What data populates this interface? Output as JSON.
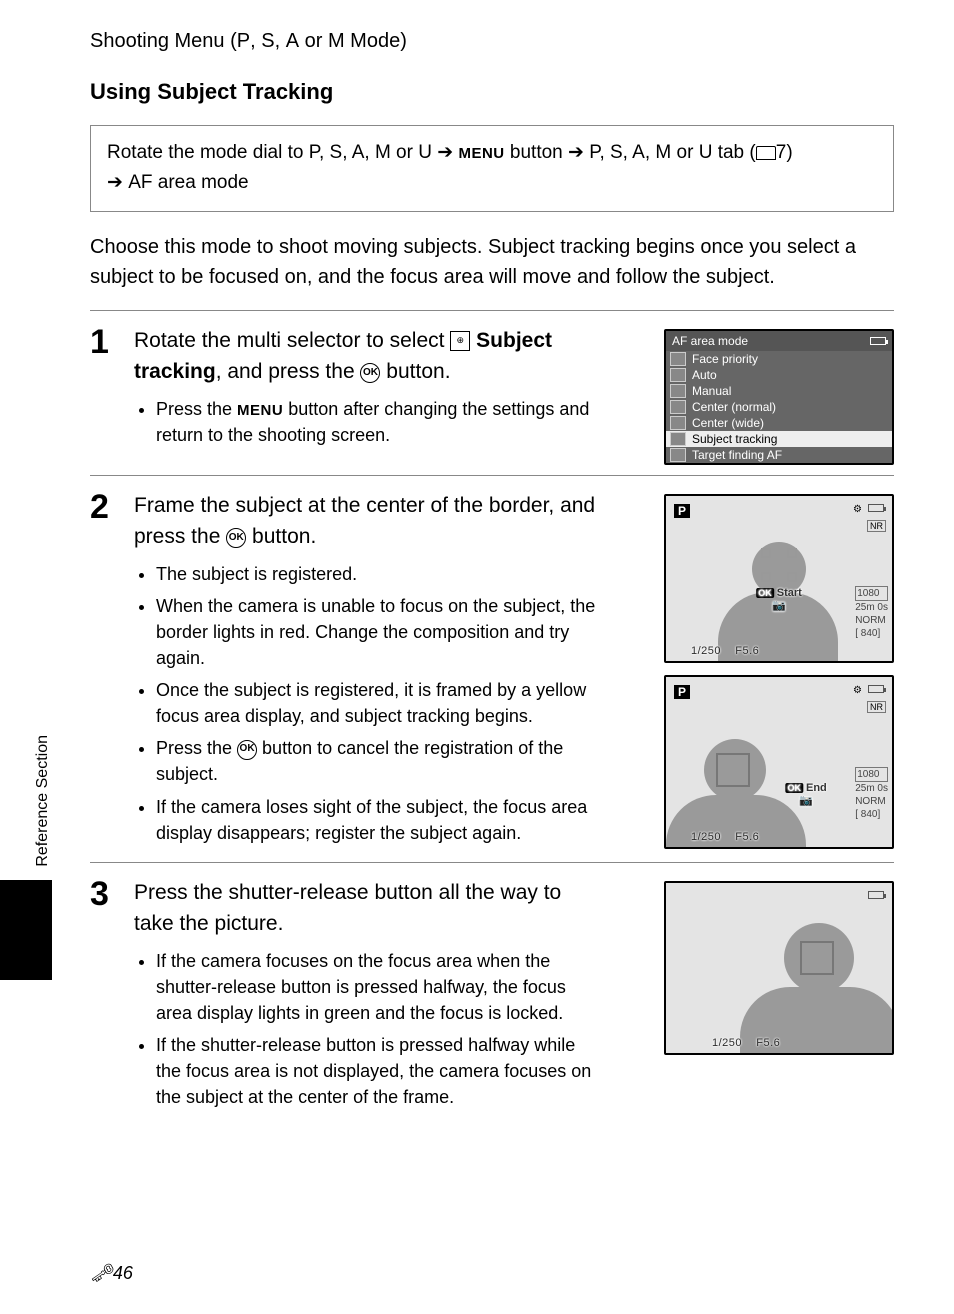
{
  "header": {
    "section": "Shooting Menu (",
    "modes": [
      "P",
      "S",
      "A",
      "M"
    ],
    "section_suffix": " Mode)"
  },
  "heading": "Using Subject Tracking",
  "navbox": {
    "prefix": "Rotate the mode dial to ",
    "modes1": "P, S, A, M",
    "or1": " or ",
    "u1": "U",
    "arrow": " ➔ ",
    "menu": "MENU",
    "button_word": " button",
    "modes2": "P, S, A, M",
    "or2": " or ",
    "u2": "U",
    "tab_word": " tab (",
    "page_ref": "7",
    "close": ")",
    "af": "AF area mode"
  },
  "intro": "Choose this mode to shoot moving subjects. Subject tracking begins once you select a subject to be focused on, and the focus area will move and follow the subject.",
  "step1": {
    "num": "1",
    "head_a": "Rotate the multi selector to select ",
    "head_bold": "Subject tracking",
    "head_b": ", and press the ",
    "head_c": " button.",
    "bullet_a": "Press the ",
    "bullet_menu": "MENU",
    "bullet_b": " button after changing the settings and return to the shooting screen."
  },
  "menu_screen": {
    "title": "AF area mode",
    "items": [
      "Face priority",
      "Auto",
      "Manual",
      "Center (normal)",
      "Center (wide)",
      "Subject tracking",
      "Target finding AF"
    ],
    "selected_index": 5
  },
  "step2": {
    "num": "2",
    "head": "Frame the subject at the center of the border, and press the ",
    "head_c": " button.",
    "bullets": [
      "The subject is registered.",
      "When the camera is unable to focus on the subject, the border lights in red. Change the composition and try again.",
      "Once the subject is registered, it is framed by a yellow focus area display, and subject tracking begins.",
      "Press the  button to cancel the registration of the subject.",
      "If the camera loses sight of the subject, the focus area display disappears; register the subject again."
    ],
    "bullet3_pre": "Press the ",
    "bullet3_post": " button to cancel the registration of the subject."
  },
  "lcd": {
    "mode": "P",
    "start": "Start",
    "end": "End",
    "time": "25m 0s",
    "res": "1080",
    "norm": "NORM",
    "shots": "[  840]",
    "shutter": "1/250",
    "fnum": "F5.6",
    "nr": "NR"
  },
  "step3": {
    "num": "3",
    "head": "Press the shutter-release button all the way to take the picture.",
    "bullets": [
      "If the camera focuses on the focus area when the shutter-release button is pressed halfway, the focus area display lights in green and the focus is locked.",
      "If the shutter-release button is pressed halfway while the focus area is not displayed, the camera focuses on the subject at the center of the frame."
    ]
  },
  "side": "Reference Section",
  "pagenum": "46"
}
